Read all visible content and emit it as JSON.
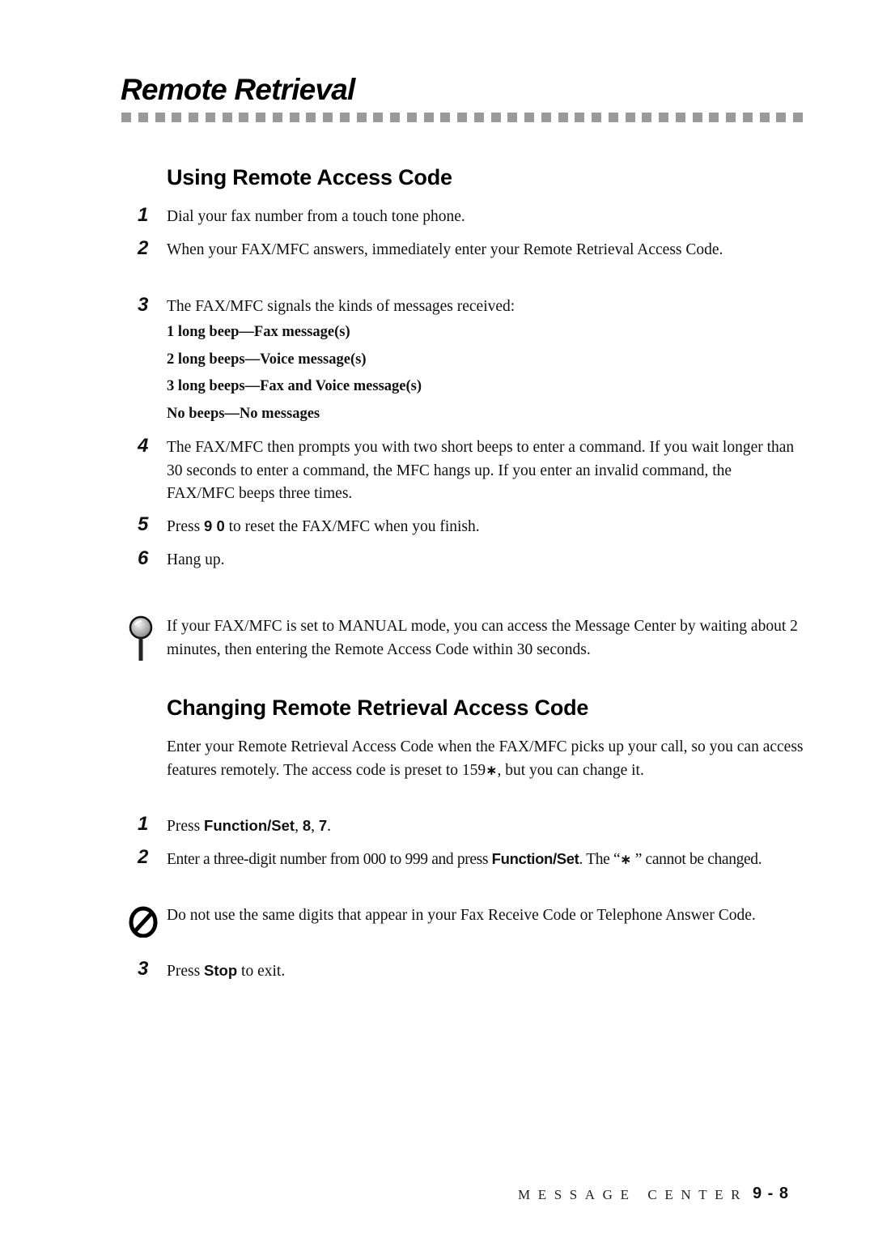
{
  "page": {
    "title": "Remote Retrieval"
  },
  "section1": {
    "heading": "Using Remote Access Code",
    "steps": [
      {
        "num": "1",
        "text": "Dial your fax number from a touch tone phone."
      },
      {
        "num": "2",
        "text": "When your FAX/MFC answers, immediately enter your Remote Retrieval Access Code."
      },
      {
        "num": "3",
        "text": "The FAX/MFC signals the kinds of messages received:"
      },
      {
        "num": "4",
        "text": "The FAX/MFC then prompts you with two short beeps to enter a command. If you wait longer than 30 seconds to enter a command, the MFC hangs up. If you enter an invalid command, the FAX/MFC beeps three times."
      },
      {
        "num": "5",
        "text_before": "Press ",
        "key": "9 0",
        "text_after": " to reset the FAX/MFC when you finish."
      },
      {
        "num": "6",
        "text": "Hang up."
      }
    ],
    "beep_signals": [
      " 1 long beep—Fax message(s)",
      " 2 long beeps—Voice message(s)",
      " 3 long beeps—Fax and Voice message(s)",
      "No beeps—No messages"
    ],
    "tip": {
      "icon": "tip-pushpin-icon",
      "text": "If your FAX/MFC is set to MANUAL mode, you can access the Message Center by waiting about 2 minutes, then entering the Remote Access Code within 30 seconds."
    }
  },
  "section2": {
    "heading": "Changing Remote Retrieval Access Code",
    "intro_before": "Enter your Remote Retrieval Access Code when the FAX/MFC picks up your call, so you can access features remotely. The access code is preset to 159",
    "intro_star": "∗",
    "intro_after": ", but you can change it.",
    "steps": [
      {
        "num": "1",
        "text_before": "Press ",
        "key1": "Function/Set",
        "mid": ", ",
        "key2": "8",
        "mid2": ", ",
        "key3": "7",
        "text_after": "."
      },
      {
        "num": "2",
        "text_before": "Enter a three-digit number from 000 to 999 and press ",
        "key": "Function/Set",
        "text_mid": ". The “",
        "star": "∗",
        "text_after": " ” cannot be changed."
      },
      {
        "num": "3",
        "text_before": "Press ",
        "key": "Stop",
        "text_after": " to exit."
      }
    ],
    "caution": {
      "icon": "prohibited-icon",
      "text": "Do not use the same digits that appear in your Fax Receive Code or Telephone Answer Code."
    }
  },
  "footer": {
    "section": "MESSAGE CENTER",
    "page_number": "9 - 8"
  }
}
